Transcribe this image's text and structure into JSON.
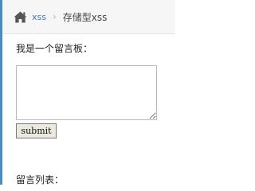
{
  "breadcrumb": {
    "home_icon": "home-icon",
    "link_label": "xss",
    "separator": "›",
    "current_label": "存储型xss"
  },
  "form": {
    "board_label": "我是一个留言板：",
    "textarea_value": "",
    "submit_label": "submit"
  },
  "list": {
    "label": "留言列表："
  },
  "colors": {
    "accent": "#4a8cc4",
    "link": "#3a7ac0",
    "breadcrumb_bg": "#f6f6f6"
  }
}
